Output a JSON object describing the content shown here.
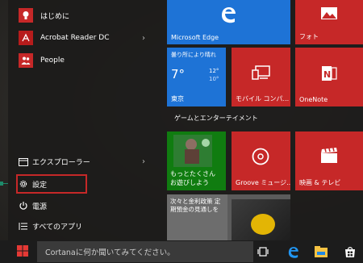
{
  "start_menu": {
    "apps": [
      {
        "label": "はじめに",
        "icon": "lightbulb-icon",
        "color": "#c62828",
        "has_chevron": false
      },
      {
        "label": "Acrobat Reader DC",
        "icon": "acrobat-icon",
        "color": "#b71c1c",
        "has_chevron": true
      },
      {
        "label": "People",
        "icon": "people-icon",
        "color": "#c62828",
        "has_chevron": false
      }
    ],
    "system": [
      {
        "label": "エクスプローラー",
        "icon": "folder-icon",
        "has_chevron": true
      },
      {
        "label": "設定",
        "icon": "gear-icon",
        "has_chevron": false
      },
      {
        "label": "電源",
        "icon": "power-icon",
        "has_chevron": false
      },
      {
        "label": "すべてのアプリ",
        "icon": "list-icon",
        "has_chevron": false
      }
    ]
  },
  "tiles": {
    "edge": {
      "label": "Microsoft Edge",
      "icon": "edge-icon",
      "color": "#1e73d6"
    },
    "photos": {
      "label": "フォト",
      "icon": "photo-icon",
      "color": "#c62828"
    },
    "weather": {
      "condition": "曇り所により晴れ",
      "temp": "7°",
      "high": "12°",
      "low": "10°",
      "city": "東京",
      "color": "#1e73d6"
    },
    "mobile": {
      "label": "モバイル コンパ...",
      "icon": "phone-pc-icon",
      "color": "#c62828"
    },
    "onenote": {
      "label": "OneNote",
      "icon": "onenote-icon",
      "color": "#c62828"
    },
    "games_group": "ゲームとエンターテイメント",
    "xbox": {
      "label_line1": "もっとたくさん",
      "label_line2": "お遊びしよう",
      "color": "#107c10"
    },
    "groove": {
      "label": "Groove ミュージ...",
      "icon": "groove-icon",
      "color": "#c62828"
    },
    "movies": {
      "label": "映画 & テレビ",
      "icon": "clapper-icon",
      "color": "#c62828"
    },
    "news": {
      "headline": "次々と金利政策 定期預金の見通しを",
      "color": "#555555"
    }
  },
  "taskbar": {
    "search_placeholder": "Cortanaに何か聞いてみてください。",
    "icons": [
      "task-view-icon",
      "edge-icon",
      "file-explorer-icon",
      "store-icon"
    ]
  }
}
